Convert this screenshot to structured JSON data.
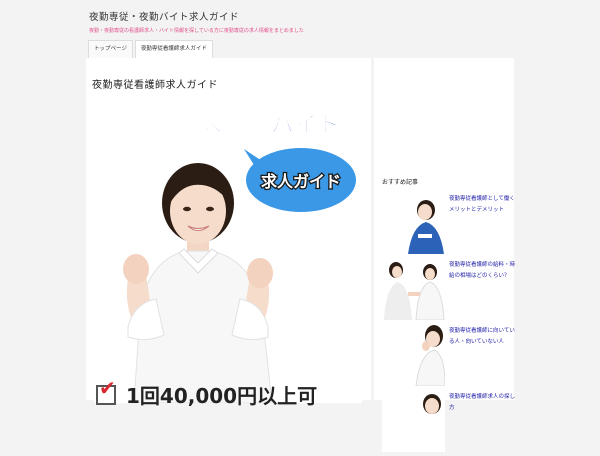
{
  "site": {
    "title": "夜勤専従・夜勤バイト求人ガイド",
    "tagline": "夜勤・夜勤専従の看護師求人・バイト情報を探している方に夜勤専従の求人情報をまとめました"
  },
  "nav": {
    "items": [
      {
        "label": "トップページ"
      },
      {
        "label": "夜勤専従看護師求人ガイド"
      }
    ]
  },
  "article": {
    "title": "夜勤専従看護師求人ガイド",
    "banner_headline": "夜勤専従＆夜勤バイト",
    "bubble_text": "求人ガイド",
    "check_text": "1回40,000円以上可"
  },
  "sidebar": {
    "heading": "おすすめ記事",
    "items": [
      {
        "label": "夜勤専従看護師として働くメリットとデメリット"
      },
      {
        "label": "夜勤専従看護師の給料・時給の相場はどのくらい？"
      },
      {
        "label": "夜勤専従看護師に向いている人・向いていない人"
      },
      {
        "label": "夜勤専従看護師求人の探し方"
      }
    ]
  },
  "colors": {
    "accent": "#e2508a",
    "link": "#1a1aa6",
    "banner_blue": "#1f4fbf",
    "bubble_blue": "#3a98e6",
    "check_red": "#d9262f"
  },
  "icons": {
    "check": "checkbox-check-icon"
  }
}
